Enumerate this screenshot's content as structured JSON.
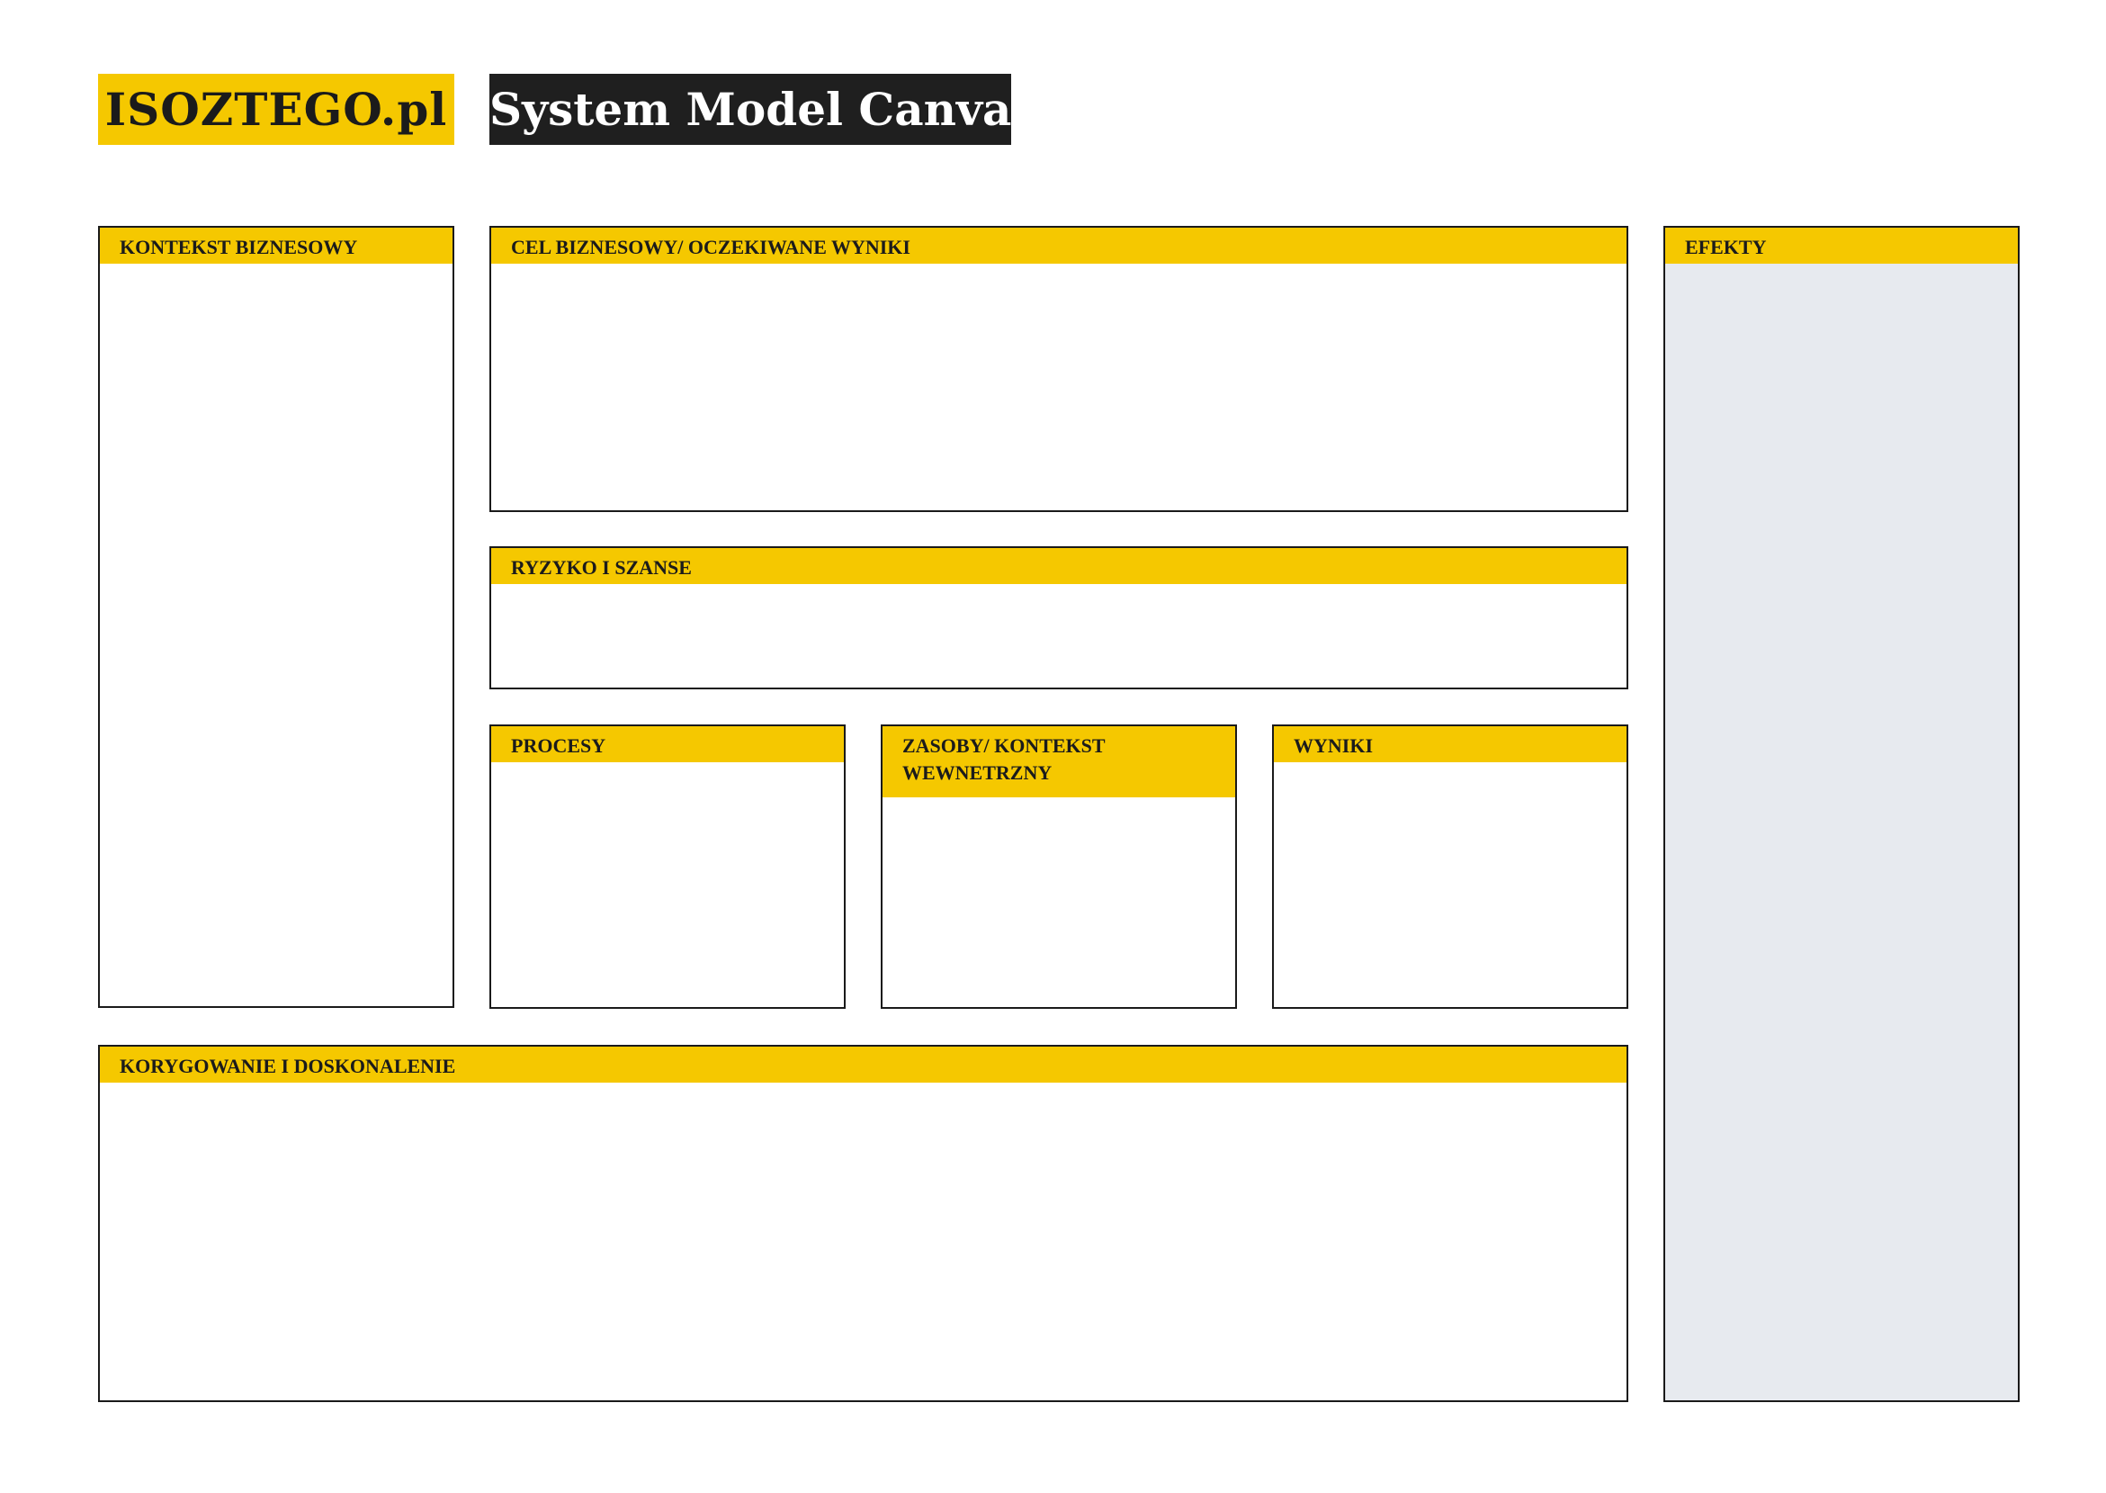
{
  "header": {
    "logo_text": "ISOZTEGO.pl",
    "title": "System Model Canvas"
  },
  "colors": {
    "accent_yellow": "#f5c800",
    "title_background": "#1f1f1f",
    "effects_background": "#e7eaef",
    "border": "#1a1a1a"
  },
  "panels": {
    "business_context": {
      "label": "KONTEKST BIZNESOWY"
    },
    "business_goal": {
      "label": "CEL BIZNESOWY/ OCZEKIWANE WYNIKI"
    },
    "risks": {
      "label": "RYZYKO I SZANSE"
    },
    "processes": {
      "label": "PROCESY"
    },
    "resources": {
      "label_line1": "ZASOBY/ KONTEKST",
      "label_line2": "WEWNETRZNY"
    },
    "results": {
      "label": "WYNIKI"
    },
    "improvement": {
      "label": "KORYGOWANIE I DOSKONALENIE"
    },
    "effects": {
      "label": "EFEKTY"
    }
  }
}
